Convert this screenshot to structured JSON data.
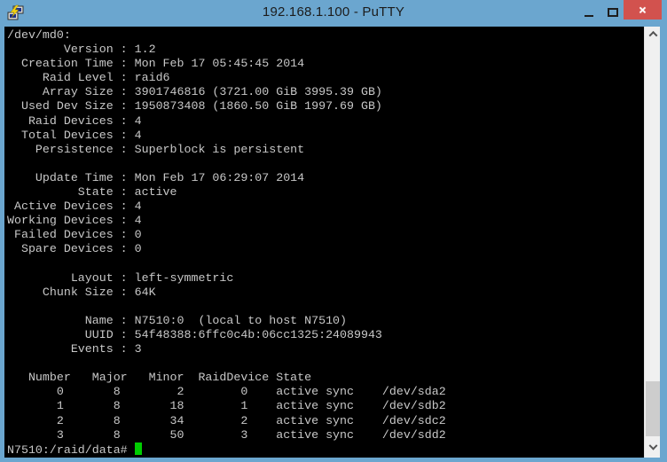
{
  "colors": {
    "frame": "#6BA6CF",
    "close_button": "#D2524E",
    "terminal_background": "#000000",
    "terminal_foreground": "#C8C8C8",
    "cursor": "#00CC00"
  },
  "window": {
    "title": "192.168.1.100 - PuTTY",
    "controls": {
      "close_glyph": "×"
    }
  },
  "terminal": {
    "lines": [
      "/dev/md0:",
      "        Version : 1.2",
      "  Creation Time : Mon Feb 17 05:45:45 2014",
      "     Raid Level : raid6",
      "     Array Size : 3901746816 (3721.00 GiB 3995.39 GB)",
      "  Used Dev Size : 1950873408 (1860.50 GiB 1997.69 GB)",
      "   Raid Devices : 4",
      "  Total Devices : 4",
      "    Persistence : Superblock is persistent",
      "",
      "    Update Time : Mon Feb 17 06:29:07 2014",
      "          State : active",
      " Active Devices : 4",
      "Working Devices : 4",
      " Failed Devices : 0",
      "  Spare Devices : 0",
      "",
      "         Layout : left-symmetric",
      "     Chunk Size : 64K",
      "",
      "           Name : N7510:0  (local to host N7510)",
      "           UUID : 54f48388:6ffc0c4b:06cc1325:24089943",
      "         Events : 3",
      "",
      "   Number   Major   Minor  RaidDevice State",
      "       0       8        2        0    active sync    /dev/sda2",
      "       1       8       18        1    active sync    /dev/sdb2",
      "       2       8       34        2    active sync    /dev/sdc2",
      "       3       8       50        3    active sync    /dev/sdd2"
    ],
    "prompt": "N7510:/raid/data# "
  }
}
